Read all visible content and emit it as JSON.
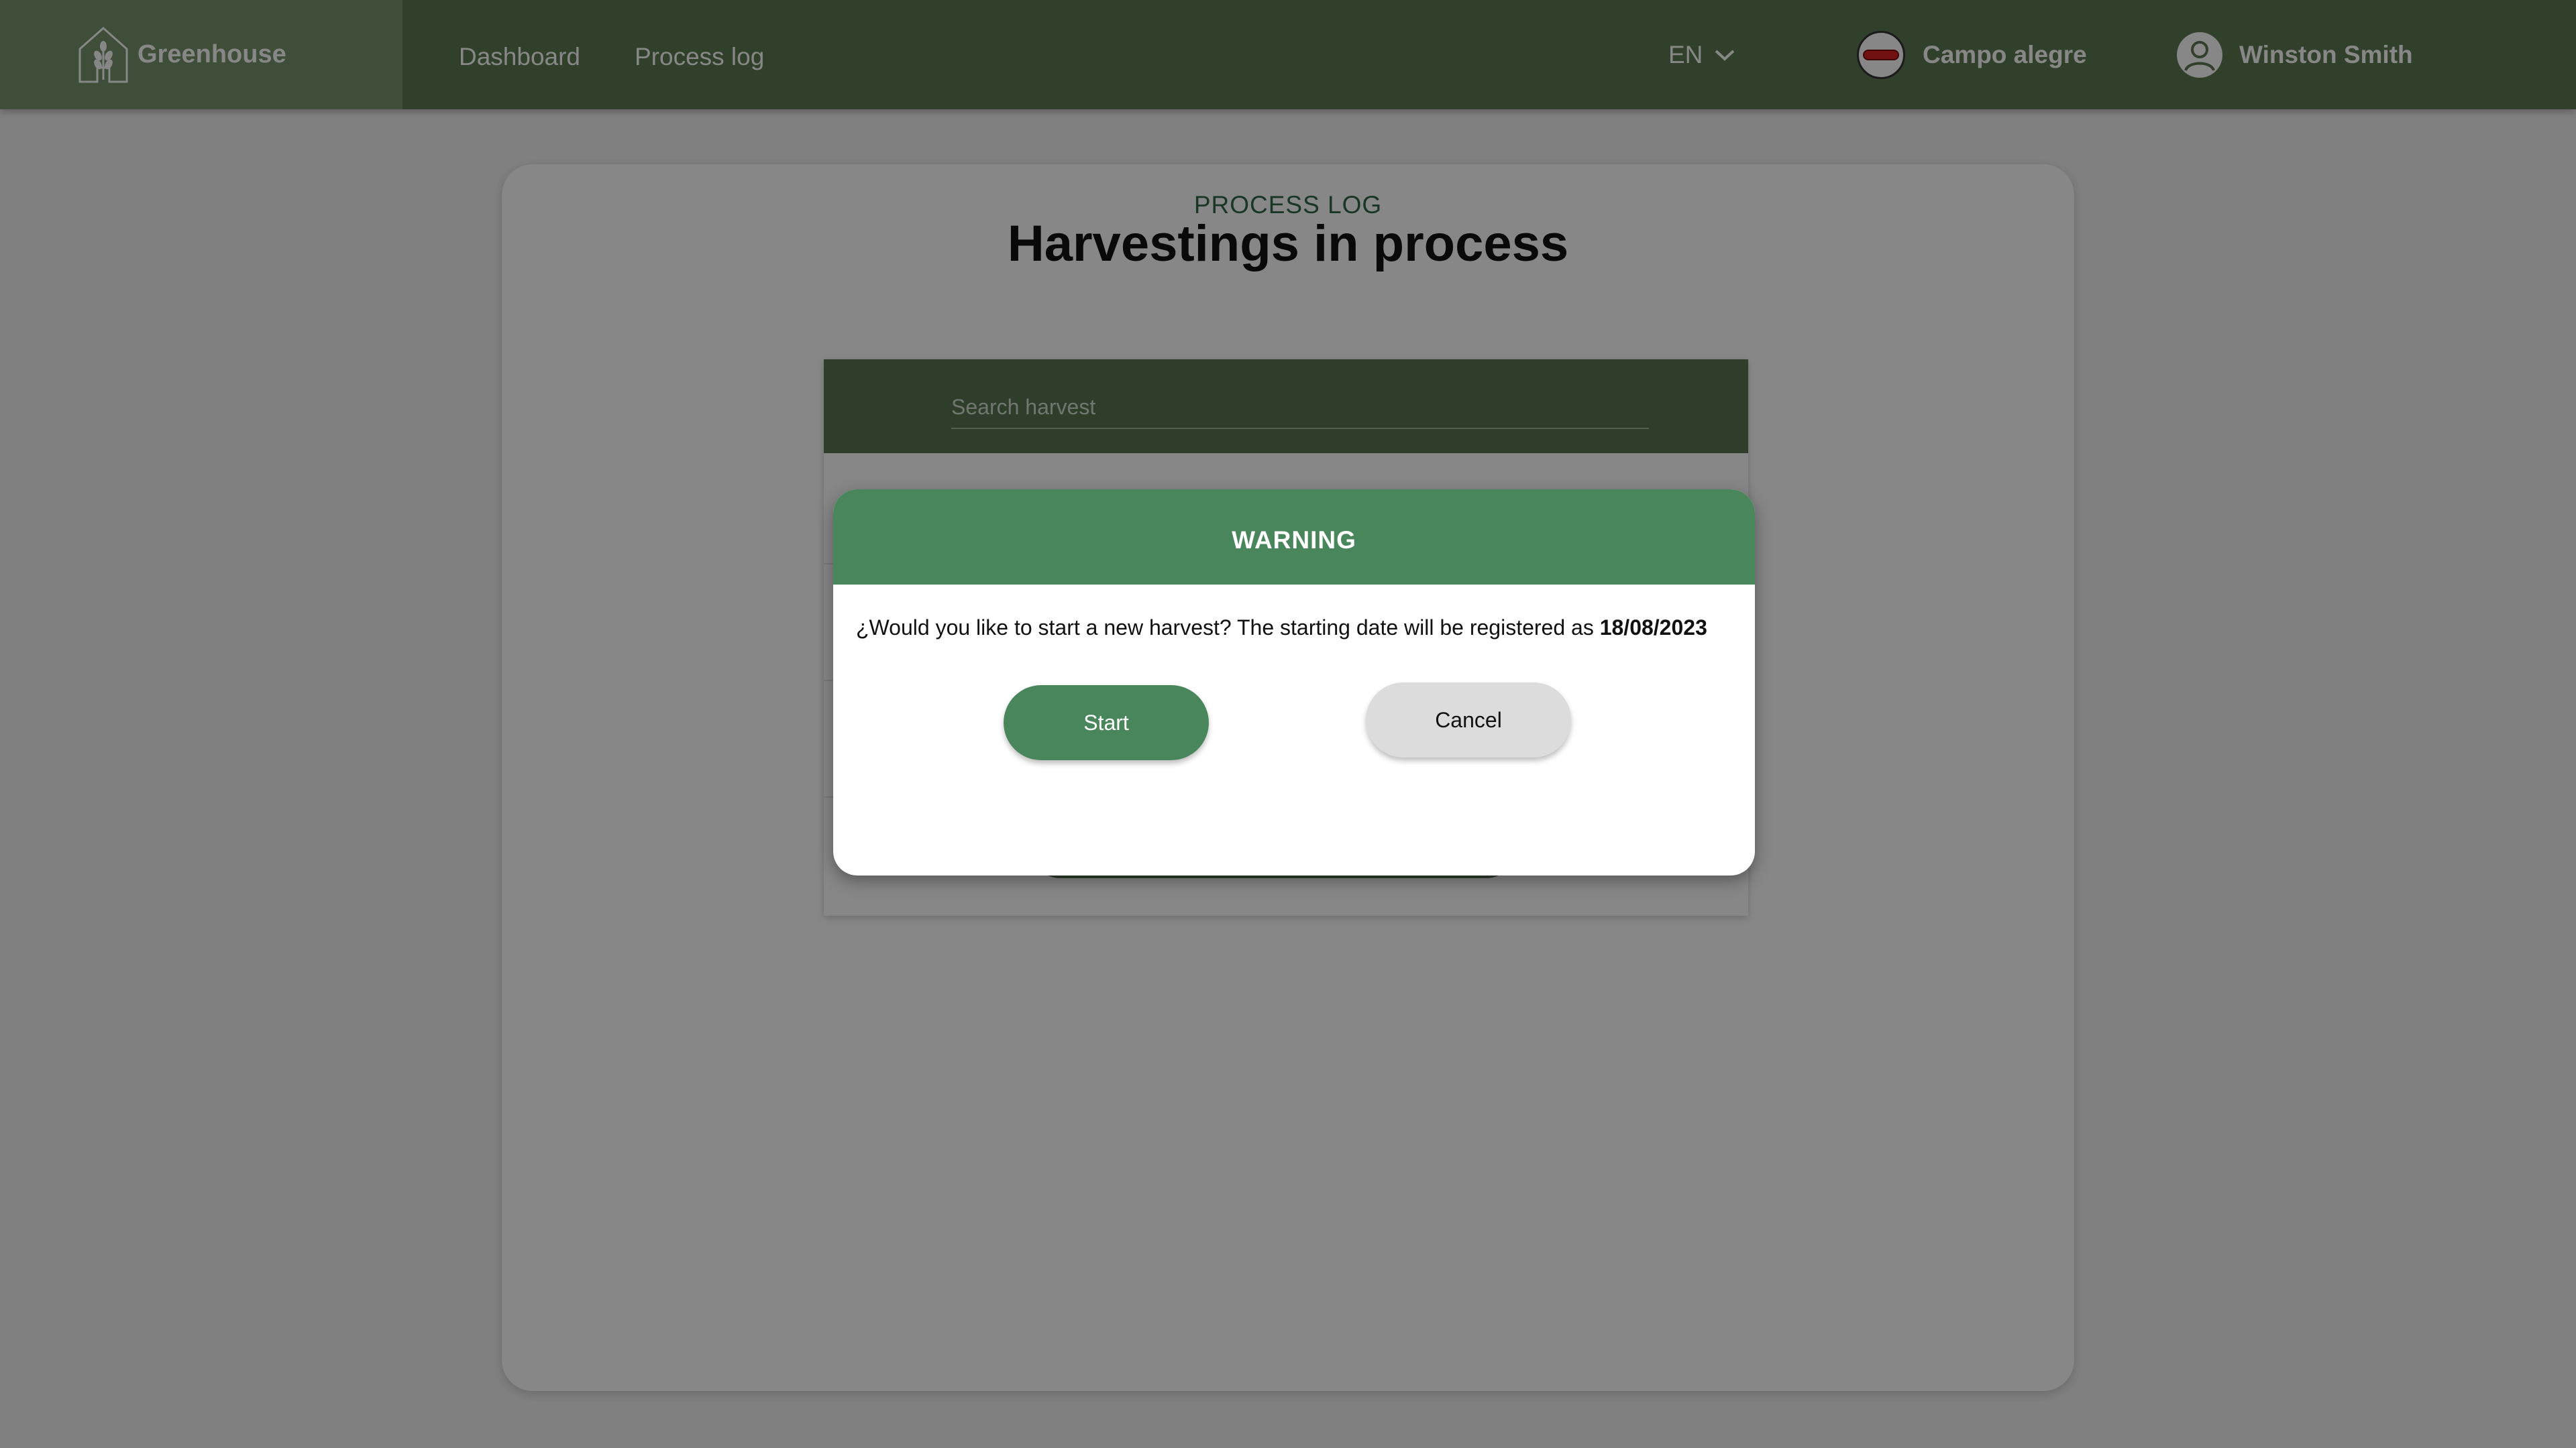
{
  "app": {
    "name": "Greenhouse"
  },
  "nav": {
    "items": [
      {
        "label": "Dashboard"
      },
      {
        "label": "Process log"
      }
    ]
  },
  "header": {
    "language": "EN",
    "farm": "Campo alegre",
    "user": "Winston Smith"
  },
  "page": {
    "eyebrow": "PROCESS LOG",
    "title": "Harvestings in process"
  },
  "search": {
    "placeholder": "Search harvest"
  },
  "dialog": {
    "title": "WARNING",
    "message": "¿Would you like to start a new harvest? The starting date will be registered as",
    "date": "18/08/2023",
    "start_label": "Start",
    "cancel_label": "Cancel"
  },
  "colors": {
    "topbar": "#5d7a52",
    "brand_block": "#76936b",
    "accent_green": "#4a865b",
    "heading_green": "#2f6a47"
  },
  "icons": {
    "logo": "greenhouse-wheat-icon",
    "language_dropdown": "chevron-down-icon",
    "farm": "farm-badge-icon",
    "user": "user-avatar-icon"
  }
}
